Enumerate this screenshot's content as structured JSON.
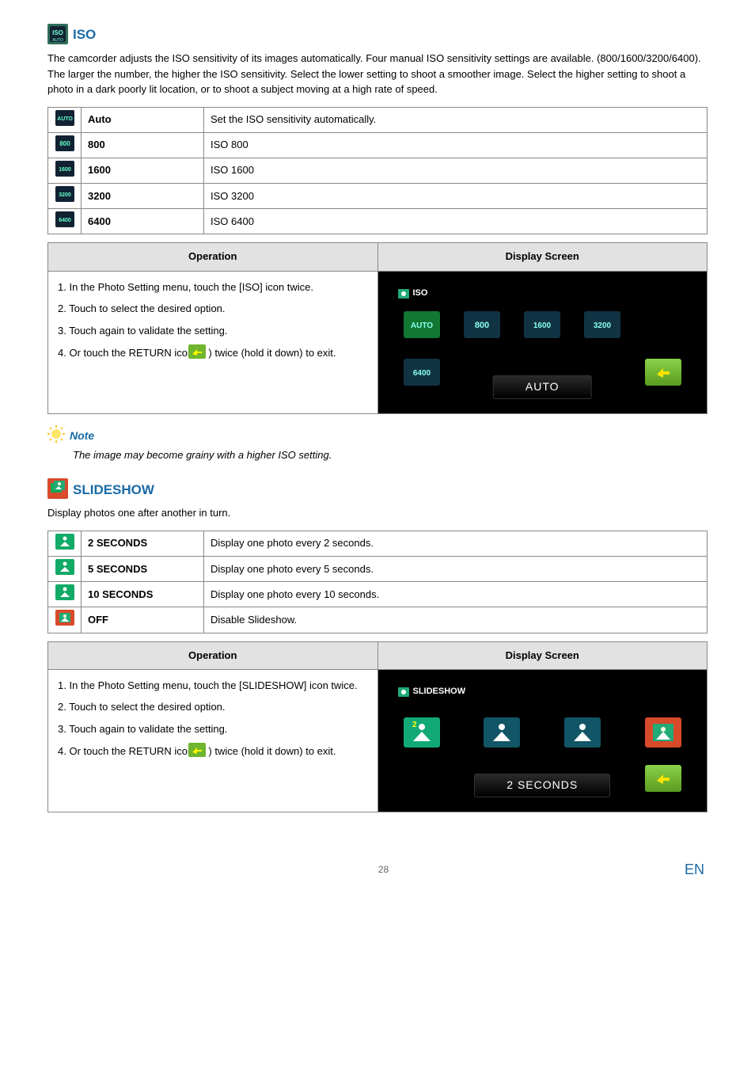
{
  "iso": {
    "title": "ISO",
    "intro": "The camcorder adjusts the ISO sensitivity of its images automatically. Four manual ISO sensitivity settings are available. (800/1600/3200/6400). The larger the number, the higher the ISO sensitivity. Select the lower setting to shoot a smoother image. Select the higher setting to shoot a photo in a dark poorly lit location, or to shoot a subject moving at a high rate of speed.",
    "rows": [
      {
        "label": "Auto",
        "desc": "Set the ISO sensitivity automatically."
      },
      {
        "label": "800",
        "desc": "ISO 800"
      },
      {
        "label": "1600",
        "desc": "ISO 1600"
      },
      {
        "label": "3200",
        "desc": "ISO 3200"
      },
      {
        "label": "6400",
        "desc": "ISO 6400"
      }
    ],
    "op_header": "Operation",
    "disp_header": "Display Screen",
    "ops": [
      "1.  In the Photo Setting menu, touch the [ISO] icon twice.",
      "2.  Touch to select the desired option.",
      "3.  Touch again to validate the setting.",
      "4.  Or touch the RETURN icon (        ) twice (hold it down) to exit."
    ],
    "display_title": "ISO",
    "display_bottom": "AUTO"
  },
  "note": {
    "title": "Note",
    "body": "The image may become grainy with a higher ISO setting."
  },
  "slideshow": {
    "title": "SLIDESHOW",
    "intro": "Display photos one after another in turn.",
    "rows": [
      {
        "label": "2 SECONDS",
        "desc": "Display one photo every 2 seconds."
      },
      {
        "label": "5 SECONDS",
        "desc": "Display one photo every 5 seconds."
      },
      {
        "label": "10 SECONDS",
        "desc": "Display one photo every 10 seconds."
      },
      {
        "label": "OFF",
        "desc": "Disable Slideshow."
      }
    ],
    "op_header": "Operation",
    "disp_header": "Display Screen",
    "ops": [
      "1.  In the Photo Setting menu, touch the [SLIDESHOW] icon twice.",
      "2.  Touch to select the desired option.",
      "3.  Touch again to validate the setting.",
      "4.  Or touch the RETURN icon (        ) twice (hold it down) to exit."
    ],
    "display_title": "SLIDESHOW",
    "display_bottom": "2 SECONDS"
  },
  "footer": {
    "page": "28",
    "lang": "EN"
  }
}
